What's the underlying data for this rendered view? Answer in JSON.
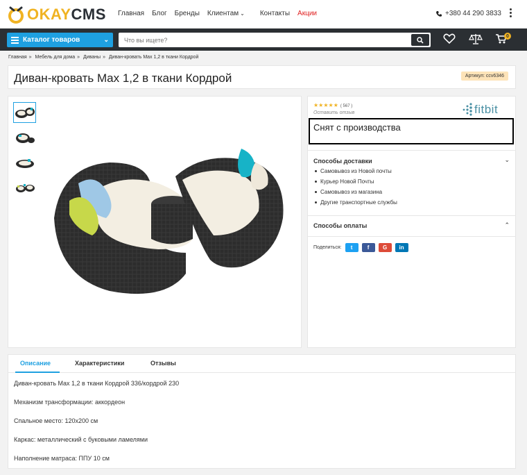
{
  "header": {
    "logo_okay": "OKAY",
    "logo_cms": "CMS",
    "nav": [
      "Главная",
      "Блог",
      "Бренды",
      "Клиентам",
      "Контакты",
      "Акции"
    ],
    "phone": "+380 44 290 3833"
  },
  "toolbar": {
    "catalog_label": "Каталог товаров",
    "search_placeholder": "Что вы ищете?",
    "cart_count": "0"
  },
  "breadcrumbs": [
    "Главная",
    "Мебель для дома",
    "Диваны",
    "Диван-кровать Max 1,2 в ткани Кордрой"
  ],
  "product": {
    "title": "Диван-кровать Max 1,2 в ткани Кордрой",
    "sku_label": "Артикул:",
    "sku_value": "ccv6346",
    "rating_stars": 5,
    "review_count": "( 567 )",
    "leave_review": "Оставить отзыв",
    "brand": "fitbit",
    "status": "Снят с производства"
  },
  "delivery": {
    "title": "Способы доставки",
    "items": [
      "Самовывоз из Новой почты",
      "Курьер Новой Почты",
      "Самовывоз из магазина",
      "Другие транспортные службы"
    ]
  },
  "payment": {
    "title": "Способы оплаты"
  },
  "share": {
    "label": "Поделиться:",
    "buttons": [
      "twitter-icon",
      "facebook-icon",
      "google-icon",
      "linkedin-icon"
    ],
    "glyphs": [
      "t",
      "f",
      "G",
      "in"
    ]
  },
  "tabs": {
    "items": [
      "Описание",
      "Характеристики",
      "Отзывы"
    ],
    "active": 0
  },
  "description": [
    "Диван-кровать Max 1,2  в ткани Кордрой 336/кордрой 230",
    "Механизм трансформации: аккордеон",
    "Спальное место: 120х200 см",
    "Каркас: металлический с буковыми ламелями",
    "Наполнение матраса: ППУ 10 см"
  ],
  "colors": {
    "accent": "#1ea0e1",
    "brand_yellow": "#f0b323",
    "dark_bar": "#2b2f33",
    "sale": "#e02020",
    "twitter": "#1da1f2",
    "facebook": "#3b5998",
    "google": "#dd4b39",
    "linkedin": "#0077b5"
  }
}
